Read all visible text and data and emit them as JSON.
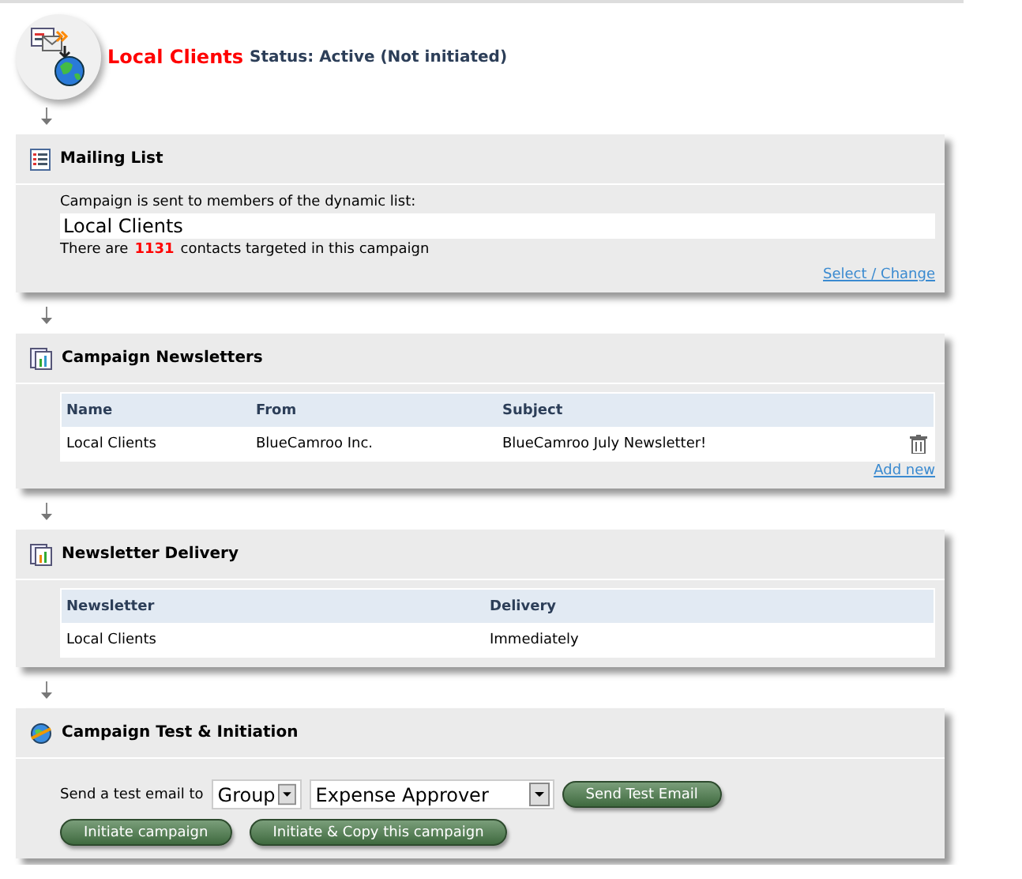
{
  "campaign": {
    "name": "Local Clients",
    "status": "Status: Active (Not initiated)"
  },
  "mailing_list": {
    "title": "Mailing List",
    "intro": "Campaign is sent to members of the dynamic list:",
    "list_name": "Local Clients",
    "count_prefix": "There are",
    "count": "1131",
    "count_suffix": "contacts targeted in this campaign",
    "link": "Select / Change"
  },
  "newsletters": {
    "title": "Campaign Newsletters",
    "columns": [
      "Name",
      "From",
      "Subject"
    ],
    "rows": [
      {
        "cells": [
          "Local Clients",
          "BlueCamroo Inc.",
          "BlueCamroo July Newsletter!"
        ]
      }
    ],
    "link": "Add new"
  },
  "delivery": {
    "title": "Newsletter Delivery",
    "columns": [
      "Newsletter",
      "Delivery"
    ],
    "rows": [
      {
        "cells": [
          "Local Clients",
          "Immediately"
        ]
      }
    ]
  },
  "test": {
    "title": "Campaign Test & Initiation",
    "label": "Send a test email to",
    "recipient_type": "Group",
    "recipient": "Expense Approver",
    "send_button": "Send Test Email",
    "buttons": [
      "Initiate campaign",
      "Initiate & Copy this campaign"
    ]
  }
}
